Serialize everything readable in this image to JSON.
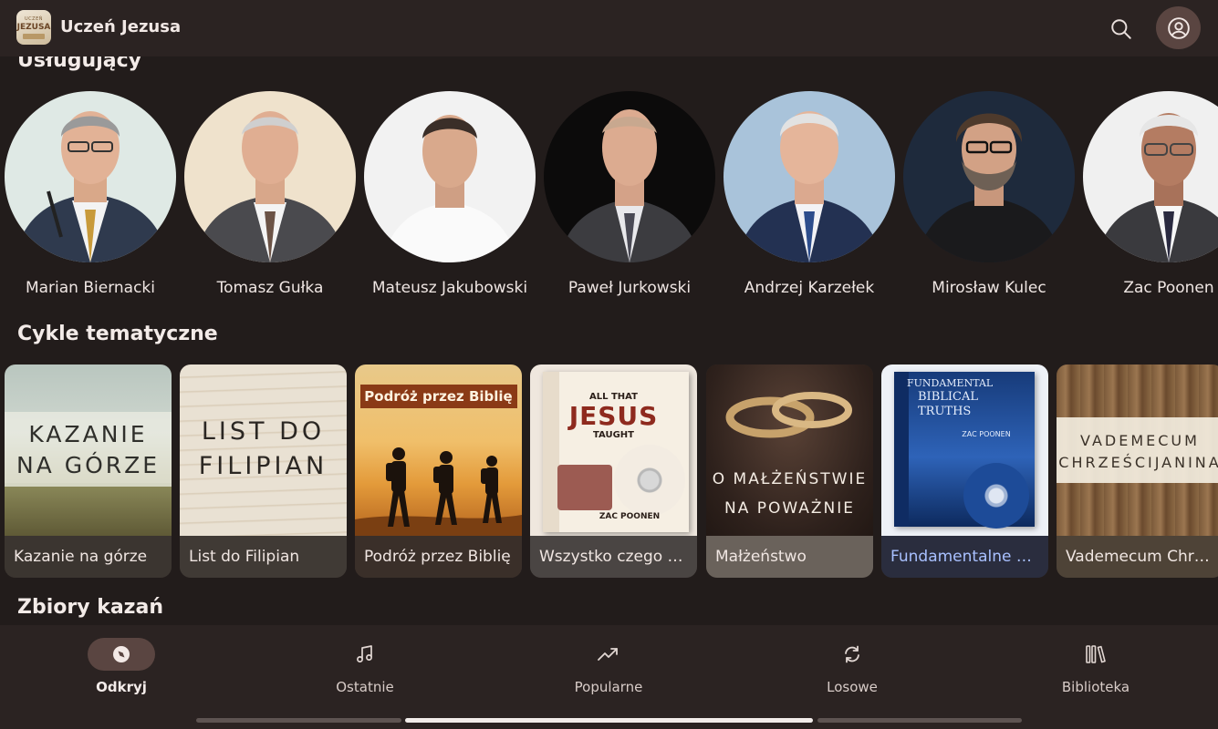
{
  "app": {
    "title": "Uczeń Jezusa",
    "logo_text_top": "UCZEŃ",
    "logo_text_main": "JEZUSA"
  },
  "header": {
    "search_icon": "search-icon",
    "account_icon": "account-circle-icon"
  },
  "sections": {
    "preachers_title": "Usługujący",
    "series_title": "Cykle tematyczne",
    "collections_title": "Zbiory kazań"
  },
  "preachers": [
    {
      "name": "Marian Biernacki"
    },
    {
      "name": "Tomasz Gułka"
    },
    {
      "name": "Mateusz Jakubowski"
    },
    {
      "name": "Paweł Jurkowski"
    },
    {
      "name": "Andrzej Karzełek"
    },
    {
      "name": "Mirosław Kulec"
    },
    {
      "name": "Zac Poonen"
    }
  ],
  "series": [
    {
      "caption": "Kazanie na górze",
      "cover_line1": "KAZANIE",
      "cover_line2": "NA GÓRZE"
    },
    {
      "caption": "List do Filipian",
      "cover_line1": "LIST DO",
      "cover_line2": "FILIPIAN"
    },
    {
      "caption": "Podróż przez Biblię",
      "cover_banner": "Podróż przez Biblię"
    },
    {
      "caption": "Wszystko czego nauczał Jezus",
      "cover_top": "ALL THAT",
      "cover_main": "JESUS",
      "cover_sub": "TAUGHT",
      "cover_author": "ZAC POONEN"
    },
    {
      "caption": "Małżeństwo",
      "cover_line1": "O MAŁŻEŃSTWIE",
      "cover_line2": "NA POWAŻNIE"
    },
    {
      "caption": "Fundamentalne prawdy biblijne",
      "cover_line1": "FUNDAMENTAL",
      "cover_line2": "BIBLICAL",
      "cover_line3": "TRUTHS",
      "cover_author": "ZAC POONEN"
    },
    {
      "caption": "Vademecum Chrześcijanina",
      "cover_line1": "VADEMECUM",
      "cover_line2": "CHRZEŚCIJANINA"
    }
  ],
  "bottom_nav": {
    "items": [
      {
        "label": "Odkryj",
        "icon": "compass-icon",
        "active": true
      },
      {
        "label": "Ostatnie",
        "icon": "music-note-icon",
        "active": false
      },
      {
        "label": "Popularne",
        "icon": "trending-up-icon",
        "active": false
      },
      {
        "label": "Losowe",
        "icon": "shuffle-repeat-icon",
        "active": false
      },
      {
        "label": "Biblioteka",
        "icon": "library-icon",
        "active": false
      }
    ]
  },
  "colors": {
    "background": "#221c1b",
    "surface": "#2b2322",
    "accent_pill": "#5a4541",
    "highlight_caption": "#a8c0ff"
  }
}
